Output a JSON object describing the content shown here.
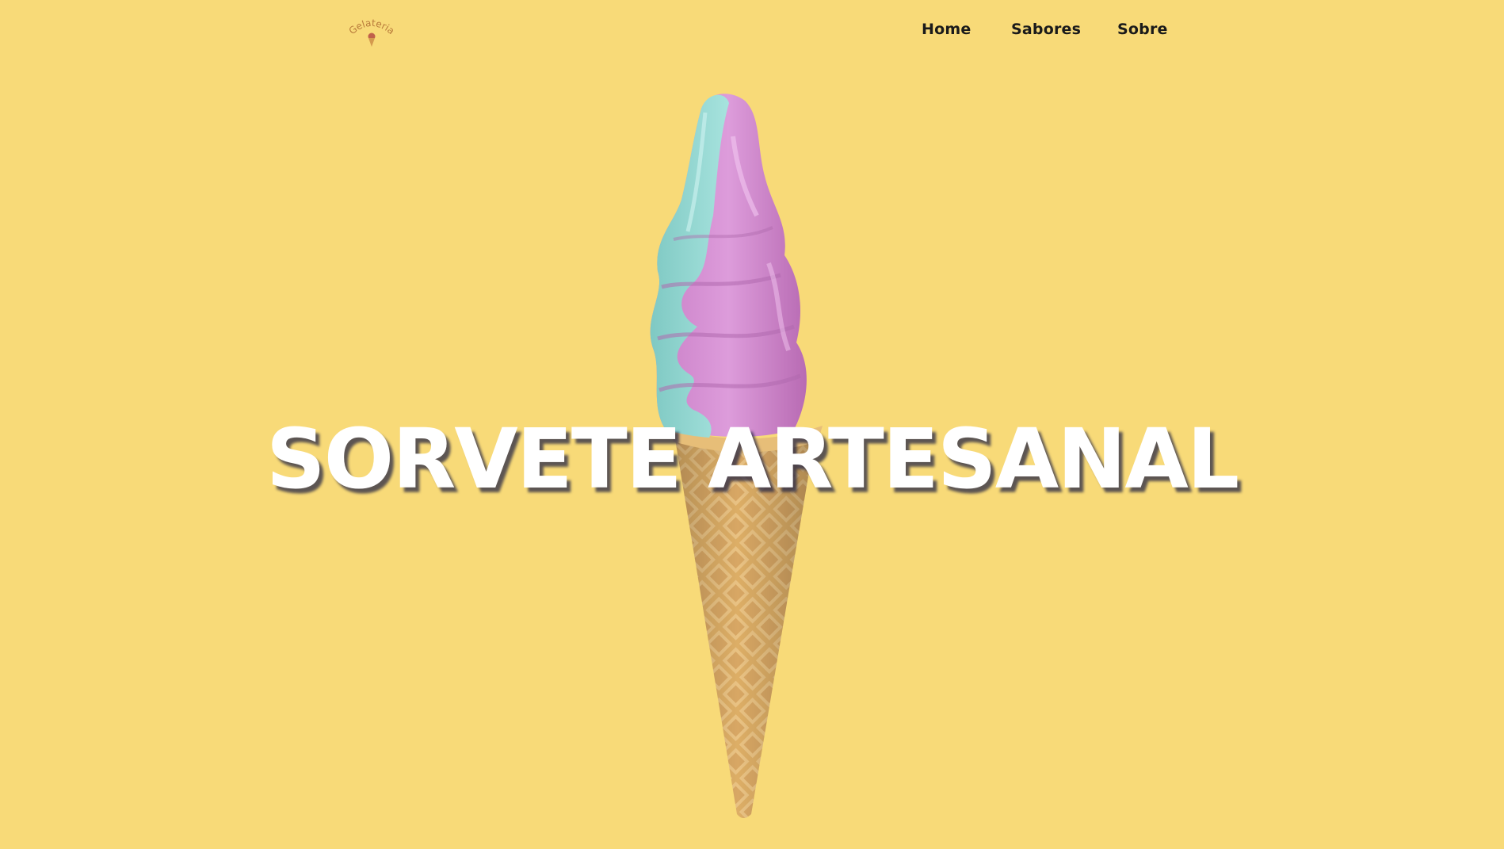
{
  "header": {
    "logo_text": "Gelateria",
    "nav": {
      "home": "Home",
      "sabores": "Sabores",
      "sobre": "Sobre"
    }
  },
  "hero": {
    "title": "SORVETE ARTESANAL"
  },
  "colors": {
    "background": "#F8DA78",
    "title_text": "#FFFFFF",
    "nav_text": "#1A1A1A",
    "scoop_pink": "#D78BD6",
    "scoop_mint": "#8FD8D2",
    "cone": "#D9A85E"
  }
}
